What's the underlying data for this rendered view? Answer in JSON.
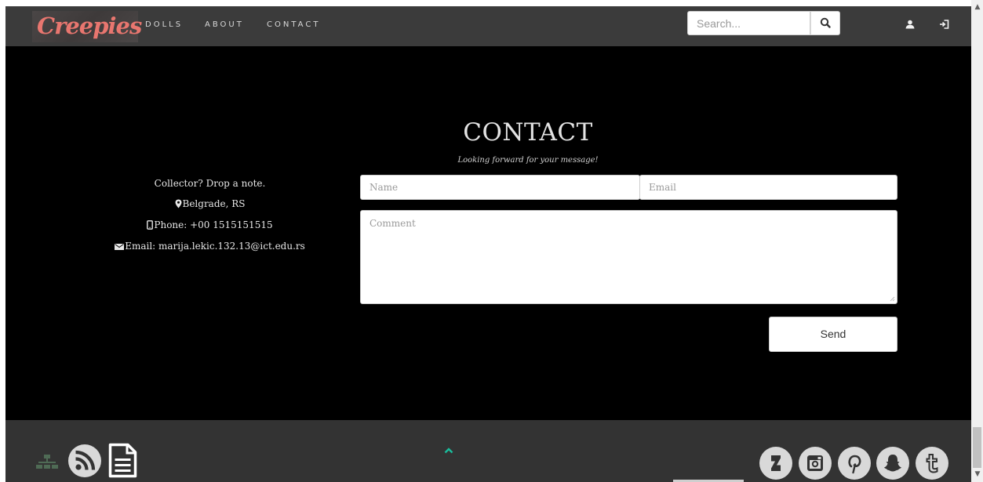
{
  "nav": {
    "brand": "Creepies",
    "links": [
      "DOLLS",
      "ABOUT",
      "CONTACT"
    ],
    "search_placeholder": "Search...",
    "icons": [
      "search-icon",
      "user-icon",
      "login-icon"
    ]
  },
  "contact": {
    "title": "CONTACT",
    "subtitle": "Looking forward for your message!",
    "info": {
      "tagline": "Collector? Drop a note.",
      "location": "Belgrade, RS",
      "phone": "Phone: +00 1515151515",
      "email": "Email: marija.lekic.132.13@ict.edu.rs"
    },
    "form": {
      "name_placeholder": "Name",
      "email_placeholder": "Email",
      "comment_placeholder": "Comment",
      "send_label": "Send"
    }
  },
  "footer": {
    "left_icons": [
      "sitemap-icon",
      "rss-icon",
      "document-icon"
    ],
    "center_icon": "chevron-up-icon",
    "social_icons": [
      "deviantart-icon",
      "instagram-icon",
      "pinterest-icon",
      "snapchat-icon",
      "tumblr-icon"
    ]
  },
  "colors": {
    "navbar": "#3b3b3b",
    "brand": "#e8766f",
    "main_bg": "#000000",
    "footer": "#333333",
    "to_top_accent": "#1abc9c"
  }
}
